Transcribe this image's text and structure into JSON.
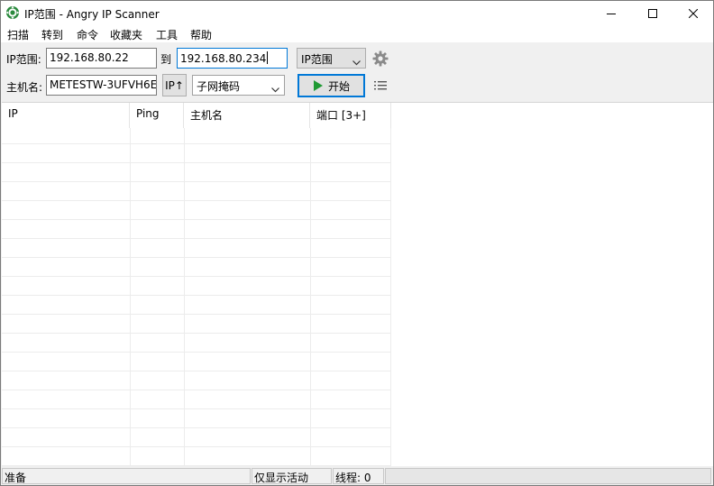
{
  "window": {
    "title": "IP范围 - Angry IP Scanner"
  },
  "menu": {
    "items": [
      "扫描",
      "转到",
      "命令",
      "收藏夹",
      "工具",
      "帮助"
    ]
  },
  "toolbar": {
    "ip_range_label": "IP范围:",
    "ip_from_value": "192.168.80.22",
    "to_label": "到",
    "ip_to_value": "192.168.80.234",
    "feeder_combo_value": "IP范围",
    "hostname_label": "主机名:",
    "hostname_value": "METESTW-3UFVH6E",
    "ip_up_button_label": "IP↑",
    "netmask_combo_value": "子网掩码",
    "start_button_label": "开始"
  },
  "table": {
    "columns": [
      "IP",
      "Ping",
      "主机名",
      "端口 [3+]"
    ]
  },
  "statusbar": {
    "state": "准备",
    "display_mode": "仅显示活动",
    "threads": "线程: 0"
  },
  "colors": {
    "start_arrow": "#1f9a33",
    "focus_border": "#0078d7",
    "app_icon": "#2b8a3e"
  },
  "icons": {
    "app": "angry-ip-scanner-icon",
    "minimize": "minimize-icon",
    "maximize": "maximize-icon",
    "close": "close-icon",
    "preferences": "gear-icon",
    "fetchers": "list-columns-icon",
    "start": "play-icon"
  }
}
